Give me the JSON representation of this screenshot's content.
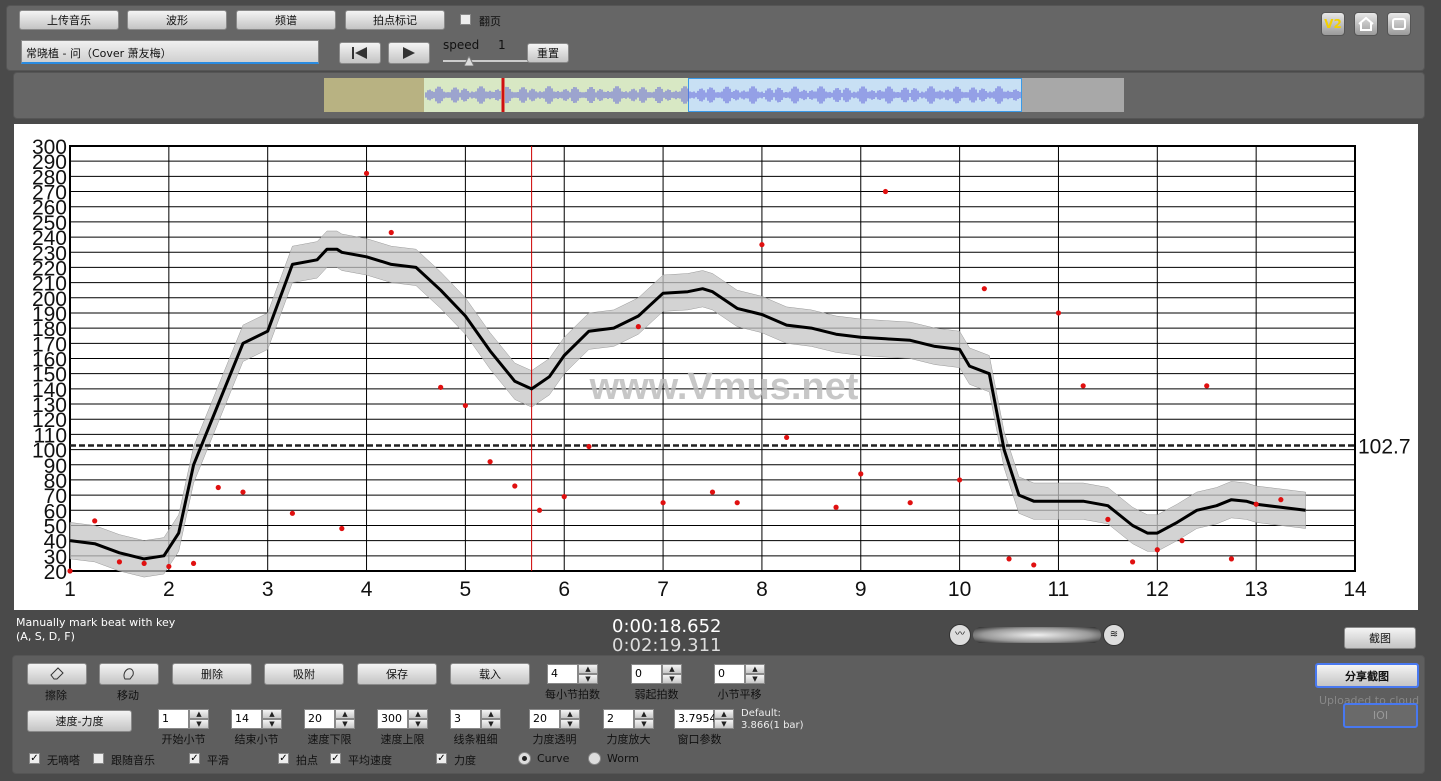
{
  "toolbar": {
    "upload_music": "上传音乐",
    "waveform": "波形",
    "spectrum": "频谱",
    "beat_marking": "拍点标记",
    "page_turn": "翻页",
    "page_turn_checked": false
  },
  "track": {
    "title": "常晓植 - 问（Cover 萧友梅）",
    "speed_label": "speed",
    "speed_value": "1",
    "reset": "重置"
  },
  "corner": {
    "v2": "V2"
  },
  "chart": {
    "y_ticks": [
      20,
      30,
      40,
      50,
      60,
      70,
      80,
      90,
      100,
      110,
      120,
      130,
      140,
      150,
      160,
      170,
      180,
      190,
      200,
      210,
      220,
      230,
      240,
      250,
      260,
      270,
      280,
      290,
      300
    ],
    "x_ticks": [
      1,
      2,
      3,
      4,
      5,
      6,
      7,
      8,
      9,
      10,
      11,
      12,
      13,
      14
    ],
    "ylim": [
      20,
      300
    ],
    "xlim": [
      1,
      14
    ],
    "average_value": 102.7,
    "average_label": "102.7",
    "playhead_x": 5.67,
    "watermark": "www.Vmus.net",
    "curve": [
      [
        1.0,
        40
      ],
      [
        1.25,
        38
      ],
      [
        1.5,
        32
      ],
      [
        1.75,
        28
      ],
      [
        1.95,
        30
      ],
      [
        2.1,
        45
      ],
      [
        2.25,
        90
      ],
      [
        2.5,
        130
      ],
      [
        2.75,
        170
      ],
      [
        3.0,
        178
      ],
      [
        3.25,
        222
      ],
      [
        3.5,
        225
      ],
      [
        3.6,
        232
      ],
      [
        3.7,
        232
      ],
      [
        3.75,
        230
      ],
      [
        4.0,
        227
      ],
      [
        4.25,
        222
      ],
      [
        4.5,
        220
      ],
      [
        4.75,
        205
      ],
      [
        5.0,
        188
      ],
      [
        5.25,
        165
      ],
      [
        5.5,
        145
      ],
      [
        5.67,
        140
      ],
      [
        5.85,
        148
      ],
      [
        6.0,
        162
      ],
      [
        6.25,
        178
      ],
      [
        6.5,
        180
      ],
      [
        6.75,
        188
      ],
      [
        7.0,
        203
      ],
      [
        7.25,
        204
      ],
      [
        7.4,
        206
      ],
      [
        7.5,
        204
      ],
      [
        7.75,
        193
      ],
      [
        8.0,
        189
      ],
      [
        8.25,
        182
      ],
      [
        8.5,
        180
      ],
      [
        8.75,
        176
      ],
      [
        9.0,
        174
      ],
      [
        9.25,
        173
      ],
      [
        9.5,
        172
      ],
      [
        9.75,
        168
      ],
      [
        10.0,
        166
      ],
      [
        10.1,
        155
      ],
      [
        10.3,
        150
      ],
      [
        10.45,
        100
      ],
      [
        10.6,
        70
      ],
      [
        10.75,
        66
      ],
      [
        11.0,
        66
      ],
      [
        11.25,
        66
      ],
      [
        11.5,
        63
      ],
      [
        11.75,
        50
      ],
      [
        11.9,
        45
      ],
      [
        12.0,
        45
      ],
      [
        12.2,
        52
      ],
      [
        12.4,
        60
      ],
      [
        12.6,
        63
      ],
      [
        12.75,
        67
      ],
      [
        12.9,
        66
      ],
      [
        13.0,
        64
      ],
      [
        13.25,
        62
      ],
      [
        13.5,
        60
      ]
    ],
    "points": [
      [
        1.0,
        20
      ],
      [
        1.25,
        53
      ],
      [
        1.5,
        26
      ],
      [
        1.75,
        25
      ],
      [
        2.0,
        23
      ],
      [
        2.25,
        25
      ],
      [
        2.5,
        75
      ],
      [
        2.75,
        72
      ],
      [
        3.25,
        58
      ],
      [
        3.75,
        48
      ],
      [
        4.0,
        282
      ],
      [
        4.25,
        243
      ],
      [
        4.75,
        141
      ],
      [
        5.0,
        129
      ],
      [
        5.25,
        92
      ],
      [
        5.5,
        76
      ],
      [
        5.75,
        60
      ],
      [
        6.0,
        69
      ],
      [
        6.25,
        102
      ],
      [
        6.75,
        181
      ],
      [
        7.0,
        65
      ],
      [
        7.5,
        72
      ],
      [
        7.75,
        65
      ],
      [
        8.0,
        235
      ],
      [
        8.25,
        108
      ],
      [
        8.75,
        62
      ],
      [
        9.0,
        84
      ],
      [
        9.25,
        270
      ],
      [
        9.5,
        65
      ],
      [
        10.0,
        80
      ],
      [
        10.25,
        206
      ],
      [
        10.5,
        28
      ],
      [
        10.75,
        24
      ],
      [
        11.0,
        190
      ],
      [
        11.25,
        142
      ],
      [
        11.5,
        54
      ],
      [
        11.75,
        26
      ],
      [
        12.0,
        34
      ],
      [
        12.25,
        40
      ],
      [
        12.5,
        142
      ],
      [
        12.75,
        28
      ],
      [
        13.0,
        64
      ],
      [
        13.25,
        67
      ]
    ],
    "colors": {
      "curve": "#000000",
      "band": "#c4c4c4",
      "points": "#e01010",
      "playhead": "#cc0000"
    }
  },
  "info": {
    "hint_line1": "Manually mark beat with key",
    "hint_line2": "(A, S, D, F)",
    "current_time": "0:00:18.652",
    "total_time": "0:02:19.311",
    "screenshot": "截图"
  },
  "controls": {
    "erase": "擦除",
    "move": "移动",
    "delete": "删除",
    "snap": "吸附",
    "save": "保存",
    "load": "载入",
    "beats_per_bar": {
      "value": "4",
      "label": "每小节拍数"
    },
    "pickup_beats": {
      "value": "0",
      "label": "弱起拍数"
    },
    "bar_offset": {
      "value": "0",
      "label": "小节平移"
    },
    "share_screenshot": "分享截图",
    "uploaded": "Uploaded to cloud",
    "ioi": "IOI",
    "tempo_dynamics": "速度-力度",
    "start_bar": {
      "value": "1",
      "label": "开始小节"
    },
    "end_bar": {
      "value": "14",
      "label": "结束小节"
    },
    "tempo_min": {
      "value": "20",
      "label": "速度下限"
    },
    "tempo_max": {
      "value": "300",
      "label": "速度上限"
    },
    "line_width": {
      "value": "3",
      "label": "线条粗细"
    },
    "dyn_opacity": {
      "value": "20",
      "label": "力度透明"
    },
    "dyn_scale": {
      "value": "2",
      "label": "力度放大"
    },
    "window_param": {
      "value": "3.7954",
      "label": "窗口参数"
    },
    "default_label": "Default:",
    "default_value": "3.866(1 bar)",
    "opt_no_tick": "无嘀嗒",
    "opt_follow_music": "跟随音乐",
    "opt_smooth": "平滑",
    "opt_beats": "拍点",
    "opt_avg_speed": "平均速度",
    "opt_dynamics": "力度",
    "radio_curve": "Curve",
    "radio_worm": "Worm"
  }
}
